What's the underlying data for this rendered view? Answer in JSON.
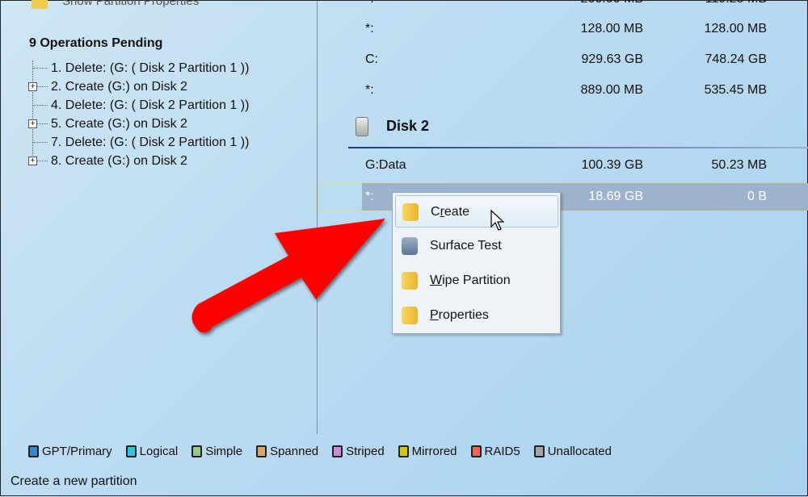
{
  "left": {
    "top_action": "Show Partition Properties",
    "ops_title": "9 Operations Pending",
    "ops": [
      {
        "label": "1. Delete: (G: ( Disk 2 Partition 1 ))",
        "expandable": false
      },
      {
        "label": "2. Create (G:) on Disk 2",
        "expandable": true
      },
      {
        "label": "4. Delete: (G: ( Disk 2 Partition 1 ))",
        "expandable": false
      },
      {
        "label": "5. Create (G:) on Disk 2",
        "expandable": true
      },
      {
        "label": "7. Delete: (G: ( Disk 2 Partition 1 ))",
        "expandable": false
      },
      {
        "label": "8. Create (G:) on Disk 2",
        "expandable": true
      }
    ]
  },
  "partitions": {
    "rows": [
      {
        "name": "*:",
        "capacity": "128.00 MB",
        "used": "128.00 MB"
      },
      {
        "name": "C:",
        "capacity": "929.63 GB",
        "used": "748.24 GB"
      },
      {
        "name": "*:",
        "capacity": "889.00 MB",
        "used": "535.45 MB"
      }
    ],
    "disk2": {
      "title": "Disk 2",
      "rows": [
        {
          "name": "G:Data",
          "capacity": "100.39 GB",
          "used": "50.23 MB"
        },
        {
          "name": "*:",
          "capacity": "18.69 GB",
          "used": "0 B"
        }
      ]
    }
  },
  "context_menu": {
    "items": [
      {
        "pre": "C",
        "ul": "r",
        "post": "eate",
        "icon": "create-partition-icon"
      },
      {
        "pre": "Surface Test",
        "ul": "",
        "post": "",
        "icon": "surface-test-icon"
      },
      {
        "pre": "",
        "ul": "W",
        "post": "ipe Partition",
        "icon": "wipe-partition-icon"
      },
      {
        "pre": "",
        "ul": "P",
        "post": "roperties",
        "icon": "properties-icon"
      }
    ]
  },
  "legend": [
    {
      "label": "GPT/Primary",
      "color": "#3a85c8"
    },
    {
      "label": "Logical",
      "color": "#2fc7e6"
    },
    {
      "label": "Simple",
      "color": "#98c98a"
    },
    {
      "label": "Spanned",
      "color": "#d6a56a"
    },
    {
      "label": "Striped",
      "color": "#c98bd8"
    },
    {
      "label": "Mirrored",
      "color": "#d2c800"
    },
    {
      "label": "RAID5",
      "color": "#f26060"
    },
    {
      "label": "Unallocated",
      "color": "#a6a6a6"
    }
  ],
  "status": "Create a new partition",
  "annotation_color": "#ff0000"
}
